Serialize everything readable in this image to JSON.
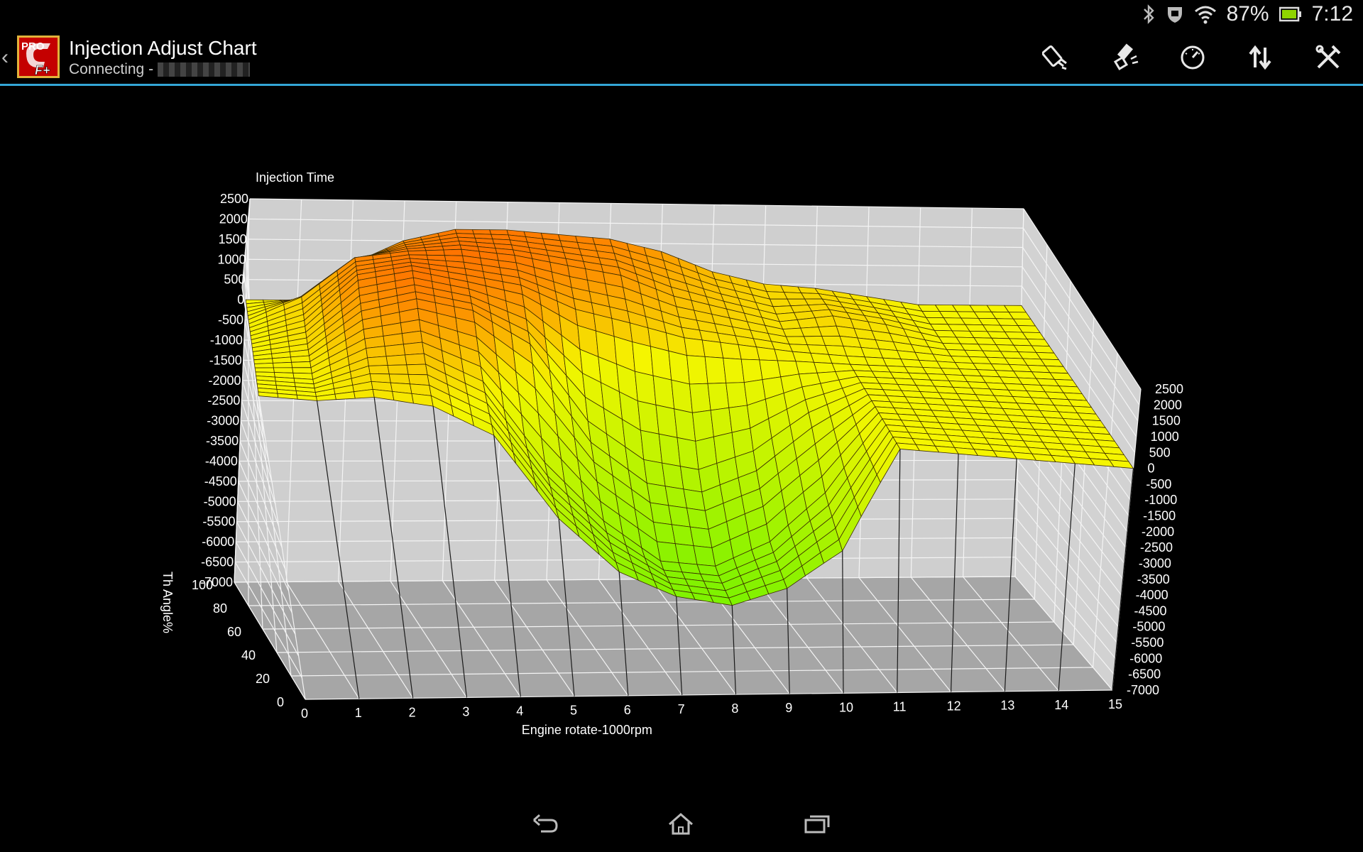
{
  "statusbar": {
    "battery_percent": "87%",
    "time": "7:12",
    "icons": [
      "bluetooth-icon",
      "vibrate-icon",
      "wifi-icon",
      "battery-icon"
    ]
  },
  "app_bar": {
    "title": "Injection Adjust Chart",
    "subtitle": "Connecting -",
    "logo_text": "PRO",
    "logo_sub": "F+",
    "actions": [
      "injector-icon",
      "spark-plug-icon",
      "gauge-icon",
      "transfer-icon",
      "tools-icon"
    ]
  },
  "colors": {
    "accent": "#33a6d6",
    "surface_low": "#7cf200",
    "surface_mid": "#f5f500",
    "surface_high": "#ff6a00",
    "wall": "#cfcfcf",
    "floor": "#a6a6a6"
  },
  "chart_data": {
    "type": "surface3d",
    "zlabel": "Injection Time",
    "xlabel": "Engine rotate-1000rpm",
    "ylabel": "Th Angle%",
    "x_ticks": [
      "0",
      "1",
      "2",
      "3",
      "4",
      "5",
      "6",
      "7",
      "8",
      "9",
      "10",
      "11",
      "12",
      "13",
      "14",
      "15"
    ],
    "y_ticks": [
      "0",
      "20",
      "40",
      "60",
      "80",
      "100"
    ],
    "z_ticks_left": [
      "2500",
      "2000",
      "1500",
      "1000",
      "500",
      "0",
      "-500",
      "-1000",
      "-1500",
      "-2000",
      "-2500",
      "-3000",
      "-3500",
      "-4000",
      "-4500",
      "-5000",
      "-5500",
      "-6000",
      "-6500",
      "-7000"
    ],
    "z_ticks_right": [
      "2500",
      "2000",
      "1500",
      "1000",
      "500",
      "0",
      "-500",
      "-1000",
      "-1500",
      "-2000",
      "-2500",
      "-3000",
      "-3500",
      "-4000",
      "-4500",
      "-5000",
      "-5500",
      "-6000",
      "-6500",
      "-7000"
    ],
    "xlim": [
      0,
      15
    ],
    "ylim": [
      0,
      100
    ],
    "zlim": [
      -7000,
      2500
    ],
    "surface": {
      "x": [
        0,
        1,
        2,
        3,
        4,
        5,
        6,
        7,
        8,
        9,
        10,
        11,
        12,
        13,
        14,
        15
      ],
      "y": [
        0,
        20,
        40,
        60,
        80,
        100
      ],
      "z": [
        [
          0,
          0,
          200,
          100,
          -500,
          -2500,
          -3800,
          -4400,
          -4600,
          -4100,
          -3000,
          0,
          0,
          0,
          0,
          0
        ],
        [
          0,
          0,
          600,
          800,
          200,
          -1800,
          -3200,
          -4200,
          -4300,
          -3600,
          -2200,
          0,
          0,
          0,
          0,
          0
        ],
        [
          0,
          200,
          1200,
          1600,
          1400,
          600,
          -1400,
          -2400,
          -2600,
          -2000,
          -800,
          0,
          0,
          0,
          0,
          0
        ],
        [
          0,
          400,
          1600,
          1900,
          1700,
          1500,
          900,
          600,
          300,
          200,
          100,
          0,
          0,
          0,
          0,
          0
        ],
        [
          0,
          600,
          1600,
          1800,
          1900,
          1800,
          1600,
          1400,
          900,
          600,
          300,
          500,
          300,
          0,
          0,
          0
        ],
        [
          0,
          0,
          900,
          1500,
          1800,
          1800,
          1700,
          1600,
          1300,
          800,
          500,
          400,
          200,
          0,
          0,
          0
        ]
      ]
    }
  }
}
